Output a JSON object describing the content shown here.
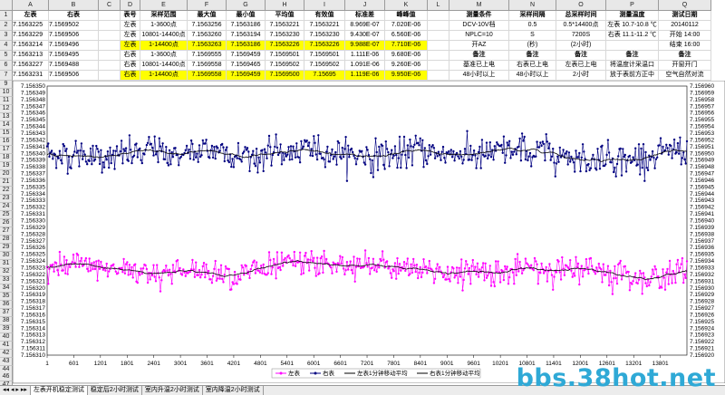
{
  "col_headers": [
    "A",
    "B",
    "C",
    "D",
    "E",
    "F",
    "G",
    "H",
    "I",
    "J",
    "K",
    "L",
    "M",
    "N",
    "O",
    "P",
    "Q"
  ],
  "row_numbers": [
    "1",
    "2",
    "3",
    "4",
    "5",
    "6",
    "7",
    "8",
    "9",
    "10",
    "11",
    "12",
    "13",
    "14",
    "15",
    "16",
    "17",
    "18",
    "19",
    "20",
    "21",
    "22",
    "23",
    "24",
    "25",
    "26",
    "27",
    "28",
    "29",
    "30",
    "31",
    "32",
    "33",
    "34",
    "35",
    "36",
    "37",
    "38",
    "39",
    "40",
    "41",
    "42",
    "43",
    "44",
    "45",
    "46",
    "47"
  ],
  "grid_rows": [
    [
      "左表",
      "右表",
      "",
      "表号",
      "采样范围",
      "最大值",
      "最小值",
      "平均值",
      "有效值",
      "标准差",
      "峰峰值",
      "",
      "测量条件",
      "采样间隔",
      "总采样时间",
      "测量温度",
      "测试日期"
    ],
    [
      "7.1563225",
      "7.1569502",
      "",
      "左表",
      "1-3600点",
      "7.1563256",
      "7.1563186",
      "7.1563221",
      "7.1563221",
      "8.969E-07",
      "7.020E-06",
      "",
      "DCV-10V档",
      "0.5",
      "0.5*14400点",
      "左表  10.7-10.8 ℃",
      "20140112"
    ],
    [
      "7.1563229",
      "7.1569506",
      "",
      "左表",
      "10801-14400点",
      "7.1563260",
      "7.1563194",
      "7.1563230",
      "7.1563230",
      "9.430E-07",
      "6.560E-06",
      "",
      "NPLC=10",
      "S",
      "7200S",
      "右表  11.1-11.2 ℃",
      "开始 14:00"
    ],
    [
      "7.1563214",
      "7.1569496",
      "",
      "左表",
      "1-14400点",
      "7.1563263",
      "7.1563186",
      "7.1563226",
      "7.1563226",
      "9.988E-07",
      "7.710E-06",
      "",
      "开AZ",
      "(秒)",
      "(2小时)",
      "",
      "结束 16:00"
    ],
    [
      "7.1563213",
      "7.1569495",
      "",
      "右表",
      "1-3600点",
      "7.1569555",
      "7.1569459",
      "7.1569501",
      "7.1569501",
      "1.111E-06",
      "9.680E-06",
      "",
      "备注",
      "备注",
      "备注",
      "备注",
      "备注"
    ],
    [
      "7.1563227",
      "7.1569488",
      "",
      "右表",
      "10801-14400点",
      "7.1569558",
      "7.1569465",
      "7.1569502",
      "7.1569502",
      "1.091E-06",
      "9.260E-06",
      "",
      "基准已上电",
      "右表已上电",
      "左表已上电",
      "将温度计采温口",
      "开窗开门"
    ],
    [
      "7.1563231",
      "7.1569506",
      "",
      "右表",
      "1-14400点",
      "7.1569558",
      "7.1569459",
      "7.1569500",
      "7.15695",
      "1.119E-06",
      "9.950E-06",
      "",
      "48小时以上",
      "48小时以上",
      "2小时",
      "放于表前方正中",
      "空气自然对流"
    ],
    [
      "",
      "",
      "",
      "",
      "",
      "",
      "",
      "",
      "",
      "",
      "",
      "",
      "",
      "两表屏幕消隐",
      "基准为LTZ1000",
      "3cm位置",
      ""
    ]
  ],
  "bottom_row": [
    "7.1563213",
    "7.1569501"
  ],
  "chart_data": {
    "type": "line",
    "x_ticks": [
      "1",
      "601",
      "1201",
      "1801",
      "2401",
      "3001",
      "3601",
      "4201",
      "4801",
      "5401",
      "6001",
      "6601",
      "7201",
      "7801",
      "8401",
      "9001",
      "9601",
      "10201",
      "10801",
      "11401",
      "12001",
      "12601",
      "13201",
      "13801"
    ],
    "xlim": [
      1,
      14400
    ],
    "left_axis": {
      "ylim": [
        7.15631,
        7.15635
      ],
      "ticks": [
        "7.156350",
        "7.156349",
        "7.156348",
        "7.156347",
        "7.156346",
        "7.156345",
        "7.156344",
        "7.156343",
        "7.156342",
        "7.156341",
        "7.156340",
        "7.156339",
        "7.156338",
        "7.156337",
        "7.156336",
        "7.156335",
        "7.156334",
        "7.156333",
        "7.156332",
        "7.156331",
        "7.156330",
        "7.156329",
        "7.156328",
        "7.156327",
        "7.156326",
        "7.156325",
        "7.156324",
        "7.156323",
        "7.156322",
        "7.156321",
        "7.156320",
        "7.156319",
        "7.156318",
        "7.156317",
        "7.156316",
        "7.156315",
        "7.156314",
        "7.156313",
        "7.156312",
        "7.156311",
        "7.156310"
      ]
    },
    "right_axis": {
      "ylim": [
        7.15692,
        7.15696
      ],
      "ticks": [
        "7.156960",
        "7.156959",
        "7.156958",
        "7.156957",
        "7.156956",
        "7.156955",
        "7.156954",
        "7.156953",
        "7.156952",
        "7.156951",
        "7.156950",
        "7.156949",
        "7.156948",
        "7.156947",
        "7.156946",
        "7.156945",
        "7.156944",
        "7.156943",
        "7.156942",
        "7.156941",
        "7.156940",
        "7.156939",
        "7.156938",
        "7.156937",
        "7.156936",
        "7.156935",
        "7.156934",
        "7.156933",
        "7.156932",
        "7.156931",
        "7.156930",
        "7.156929",
        "7.156928",
        "7.156927",
        "7.156926",
        "7.156925",
        "7.156924",
        "7.156923",
        "7.156922",
        "7.156921",
        "7.156920"
      ]
    },
    "series": [
      {
        "name": "左表",
        "axis": "left",
        "mean": 7.1563226,
        "stdev": 9.988e-07,
        "min": 7.1563186,
        "max": 7.1563263,
        "color": "#ff00ff"
      },
      {
        "name": "右表",
        "axis": "right",
        "mean": 7.15695,
        "stdev": 1.119e-06,
        "min": 7.1569459,
        "max": 7.1569558,
        "color": "#000080"
      },
      {
        "name": "左表1分钟移动平均",
        "axis": "left",
        "color": "#000000"
      },
      {
        "name": "右表1分钟移动平均",
        "axis": "right",
        "color": "#000000"
      }
    ]
  },
  "sheet_tabs": [
    "左表开机稳定测试",
    "稳定后2小时测试",
    "室内升温2小时测试",
    "室内降温2小时测试"
  ],
  "watermark": "bbs.38hot.net"
}
